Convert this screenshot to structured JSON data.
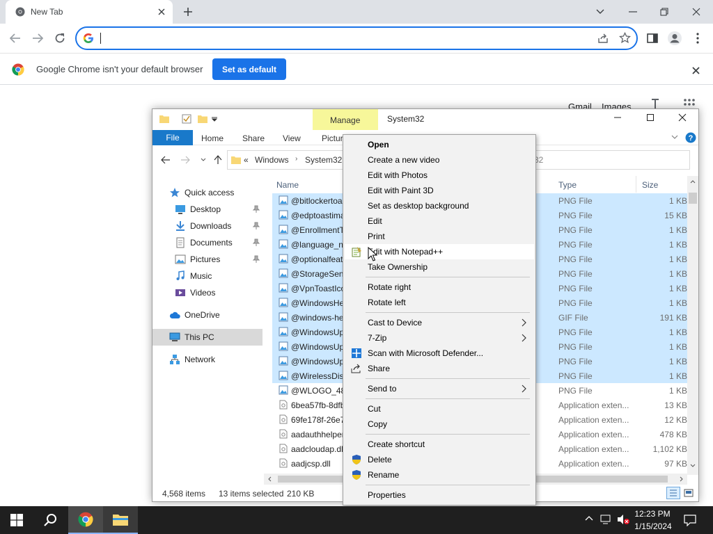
{
  "chrome": {
    "tab_title": "New Tab",
    "omnibox_value": "",
    "infobar_text": "Google Chrome isn't your default browser",
    "set_default_label": "Set as default",
    "gmail_label": "Gmail",
    "images_label": "Images"
  },
  "explorer": {
    "manage_label": "Manage",
    "title": "System32",
    "ribbon_tabs": [
      "File",
      "Home",
      "Share",
      "View",
      "Pictur"
    ],
    "breadcrumb": {
      "root": "«",
      "items": [
        "Windows",
        "System32"
      ],
      "search_placeholder": "32"
    },
    "nav": [
      {
        "label": "Quick access",
        "icon": "star-icon"
      },
      {
        "label": "Desktop",
        "icon": "desktop-icon",
        "pinned": true
      },
      {
        "label": "Downloads",
        "icon": "download-icon",
        "pinned": true
      },
      {
        "label": "Documents",
        "icon": "documents-icon",
        "pinned": true
      },
      {
        "label": "Pictures",
        "icon": "pictures-icon",
        "pinned": true
      },
      {
        "label": "Music",
        "icon": "music-icon"
      },
      {
        "label": "Videos",
        "icon": "videos-icon"
      },
      {
        "label": "OneDrive",
        "icon": "cloud-icon"
      },
      {
        "label": "This PC",
        "icon": "computer-icon",
        "selected": true
      },
      {
        "label": "Network",
        "icon": "network-icon"
      }
    ],
    "columns": {
      "name": "Name",
      "type": "Type",
      "size": "Size"
    },
    "files": [
      {
        "name": "@bitlockertoa",
        "type": "PNG File",
        "size": "1 KB",
        "selected": true,
        "kind": "image"
      },
      {
        "name": "@edptoastima",
        "type": "PNG File",
        "size": "15 KB",
        "selected": true,
        "kind": "image"
      },
      {
        "name": "@EnrollmentT",
        "type": "PNG File",
        "size": "1 KB",
        "selected": true,
        "kind": "image"
      },
      {
        "name": "@language_nc",
        "type": "PNG File",
        "size": "1 KB",
        "selected": true,
        "kind": "image"
      },
      {
        "name": "@optionalfeat",
        "type": "PNG File",
        "size": "1 KB",
        "selected": true,
        "kind": "image"
      },
      {
        "name": "@StorageSens",
        "type": "PNG File",
        "size": "1 KB",
        "selected": true,
        "kind": "image"
      },
      {
        "name": "@VpnToastIco",
        "type": "PNG File",
        "size": "1 KB",
        "selected": true,
        "kind": "image"
      },
      {
        "name": "@WindowsHe",
        "type": "PNG File",
        "size": "1 KB",
        "selected": true,
        "kind": "image"
      },
      {
        "name": "@windows-he",
        "type": "GIF File",
        "size": "191 KB",
        "selected": true,
        "kind": "image"
      },
      {
        "name": "@WindowsUp",
        "type": "PNG File",
        "size": "1 KB",
        "selected": true,
        "kind": "image"
      },
      {
        "name": "@WindowsUp",
        "type": "PNG File",
        "size": "1 KB",
        "selected": true,
        "kind": "image"
      },
      {
        "name": "@WindowsUp",
        "type": "PNG File",
        "size": "1 KB",
        "selected": true,
        "kind": "image"
      },
      {
        "name": "@WirelessDisp",
        "type": "PNG File",
        "size": "1 KB",
        "selected": true,
        "kind": "image"
      },
      {
        "name": "@WLOGO_48x",
        "type": "PNG File",
        "size": "1 KB",
        "selected": false,
        "kind": "image"
      },
      {
        "name": "6bea57fb-8dfb",
        "type": "Application exten...",
        "size": "13 KB",
        "selected": false,
        "kind": "dll"
      },
      {
        "name": "69fe178f-26e7-",
        "type": "Application exten...",
        "size": "12 KB",
        "selected": false,
        "kind": "dll"
      },
      {
        "name": "aadauthhelper",
        "type": "Application exten...",
        "size": "478 KB",
        "selected": false,
        "kind": "dll"
      },
      {
        "name": "aadcloudap.dl",
        "type": "Application exten...",
        "size": "1,102 KB",
        "selected": false,
        "kind": "dll"
      },
      {
        "name": "aadjcsp.dll",
        "type": "Application exten...",
        "size": "97 KB",
        "selected": false,
        "kind": "dll"
      }
    ],
    "status": {
      "count": "4,568 items",
      "selected": "13 items selected",
      "size": "210 KB"
    }
  },
  "context_menu": {
    "items": [
      {
        "label": "Open",
        "bold": true
      },
      {
        "label": "Create a new video"
      },
      {
        "label": "Edit with Photos"
      },
      {
        "label": "Edit with Paint 3D"
      },
      {
        "label": "Set as desktop background"
      },
      {
        "label": "Edit"
      },
      {
        "label": "Print"
      },
      {
        "label": "Edit with Notepad++",
        "icon": "notepad-plus-plus-icon",
        "hover": true
      },
      {
        "label": "Take Ownership"
      },
      {
        "sep": true
      },
      {
        "label": "Rotate right"
      },
      {
        "label": "Rotate left"
      },
      {
        "sep": true
      },
      {
        "label": "Cast to Device",
        "submenu": true
      },
      {
        "label": "7-Zip",
        "submenu": true
      },
      {
        "label": "Scan with Microsoft Defender...",
        "icon": "defender-icon"
      },
      {
        "label": "Share",
        "icon": "share-icon"
      },
      {
        "sep": true
      },
      {
        "label": "Send to",
        "submenu": true
      },
      {
        "sep": true
      },
      {
        "label": "Cut"
      },
      {
        "label": "Copy"
      },
      {
        "sep": true
      },
      {
        "label": "Create shortcut"
      },
      {
        "label": "Delete",
        "icon": "shield-icon"
      },
      {
        "label": "Rename",
        "icon": "shield-icon"
      },
      {
        "sep": true
      },
      {
        "label": "Properties"
      }
    ]
  },
  "taskbar": {
    "time": "12:23 PM",
    "date": "1/15/2024"
  },
  "colors": {
    "accent": "#1a73e8",
    "selection": "#cce8ff",
    "manage": "#f7f79a",
    "file_tab": "#1979ca"
  }
}
